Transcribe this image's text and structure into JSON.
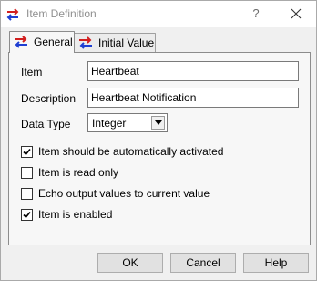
{
  "window": {
    "title": "Item Definition",
    "help_glyph": "?"
  },
  "tabs": [
    {
      "label": "General",
      "icon": "arrows-icon",
      "active": true
    },
    {
      "label": "Initial Value",
      "icon": "arrows-icon",
      "active": false
    }
  ],
  "form": {
    "item_label": "Item",
    "item_value": "Heartbeat",
    "description_label": "Description",
    "description_value": "Heartbeat Notification",
    "datatype_label": "Data Type",
    "datatype_value": "Integer"
  },
  "checkboxes": [
    {
      "label": "Item should be automatically activated",
      "checked": true
    },
    {
      "label": "Item is read only",
      "checked": false
    },
    {
      "label": "Echo output values to current value",
      "checked": false
    },
    {
      "label": "Item is enabled",
      "checked": true
    }
  ],
  "buttons": {
    "ok": "OK",
    "cancel": "Cancel",
    "help": "Help"
  },
  "colors": {
    "icon_red": "#d21f1f",
    "icon_blue": "#1f3fd2"
  }
}
